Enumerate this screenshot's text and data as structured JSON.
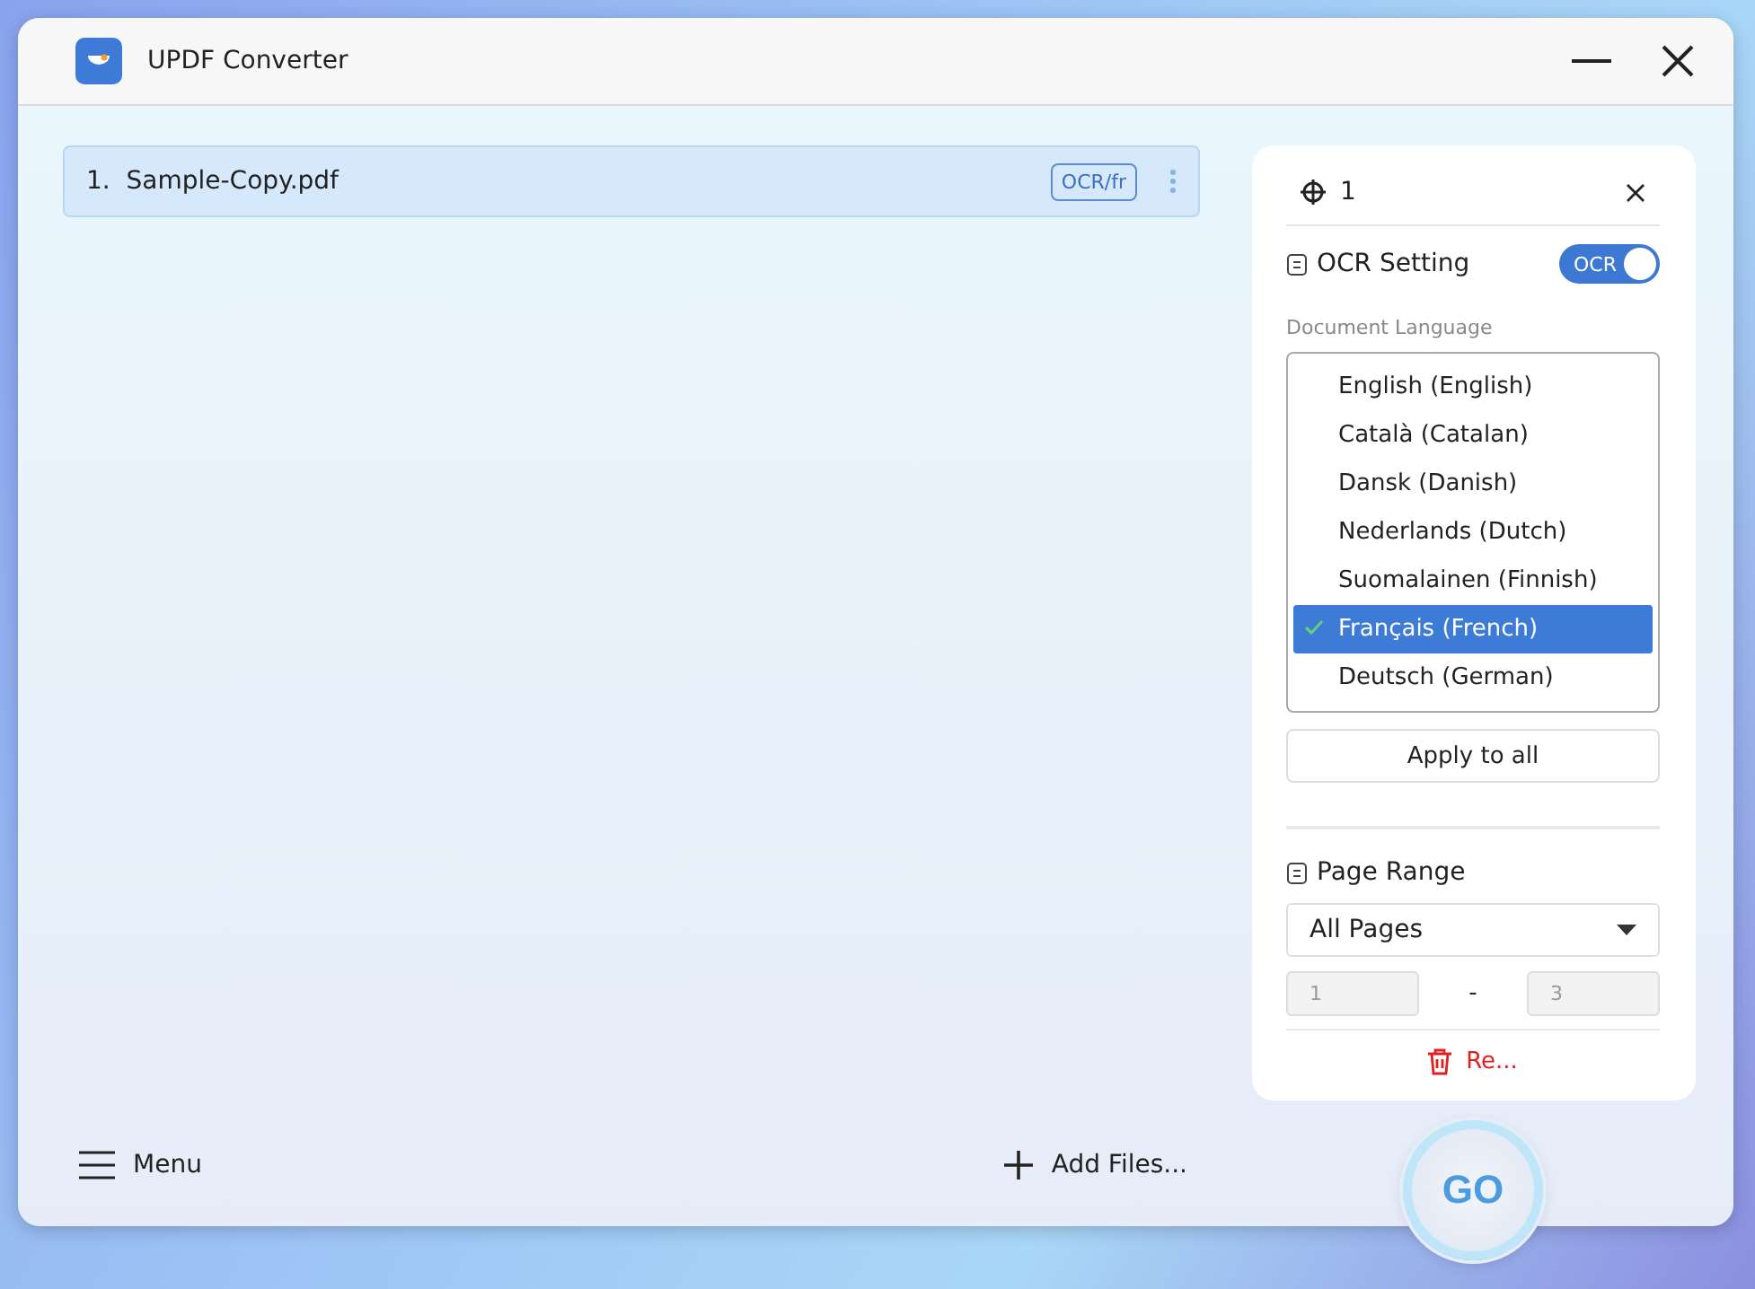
{
  "window": {
    "title": "UPDF Converter"
  },
  "files": [
    {
      "number": "1.",
      "name": "Sample-Copy.pdf",
      "badge": "OCR/fr",
      "selected": true
    }
  ],
  "panel": {
    "file_index": "1",
    "ocr": {
      "label": "OCR Setting",
      "toggle_label": "OCR",
      "on": true
    },
    "language_label": "Document Language",
    "languages": [
      {
        "label": "English (English)",
        "selected": false
      },
      {
        "label": "Català (Catalan)",
        "selected": false
      },
      {
        "label": "Dansk (Danish)",
        "selected": false
      },
      {
        "label": "Nederlands (Dutch)",
        "selected": false
      },
      {
        "label": "Suomalainen (Finnish)",
        "selected": false
      },
      {
        "label": "Français (French)",
        "selected": true
      },
      {
        "label": "Deutsch (German)",
        "selected": false
      }
    ],
    "apply_button": "Apply to all",
    "page_range": {
      "label": "Page Range",
      "value": "All Pages",
      "from": "1",
      "separator": "-",
      "to": "3"
    },
    "remove_button": "Re..."
  },
  "bottom_bar": {
    "menu": "Menu",
    "add_files": "Add Files...",
    "go": "GO"
  }
}
